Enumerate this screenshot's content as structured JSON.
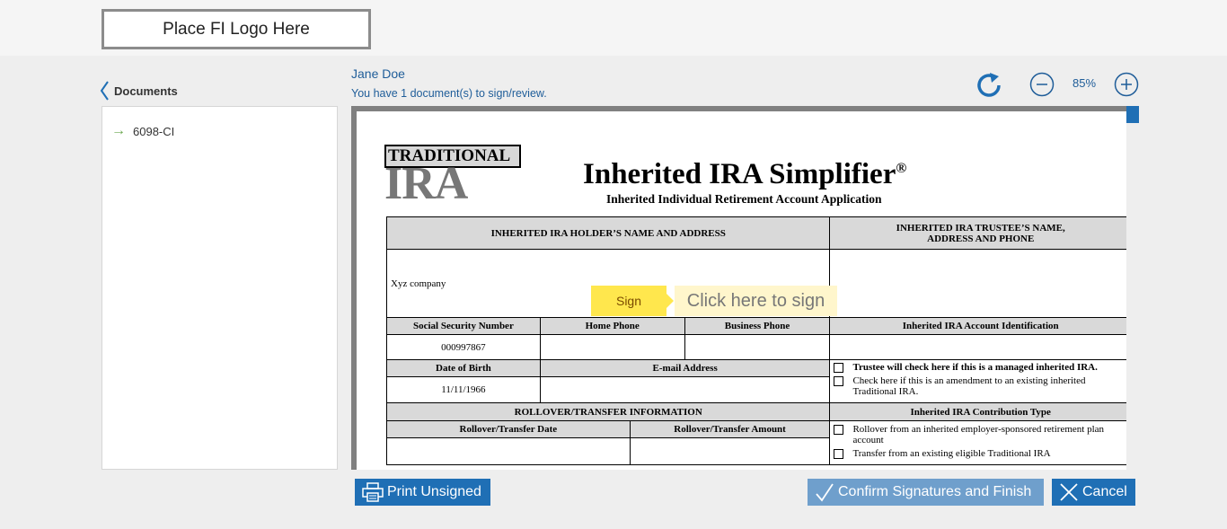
{
  "header": {
    "logo_placeholder": "Place FI Logo Here"
  },
  "sidebar": {
    "back_label": "Documents",
    "documents": [
      {
        "name": "6098-CI"
      }
    ]
  },
  "viewer_header": {
    "user_name": "Jane Doe",
    "status_text": "You have 1 document(s) to sign/review.",
    "zoom_level": "85%"
  },
  "document": {
    "logo_top": "TRADITIONAL",
    "logo_bottom": "IRA",
    "title": "Inherited IRA Simplifier",
    "title_mark": "®",
    "subtitle": "Inherited Individual Retirement Account Application",
    "holder_header": "INHERITED IRA HOLDER’S NAME AND ADDRESS",
    "trustee_header_line1": "INHERITED IRA TRUSTEE’S NAME,",
    "trustee_header_line2": "ADDRESS AND PHONE",
    "holder_name": "Xyz company",
    "ssn_label": "Social Security Number",
    "home_phone_label": "Home Phone",
    "business_phone_label": "Business Phone",
    "account_id_label": "Inherited IRA Account Identification",
    "ssn_value": "000997867",
    "dob_label": "Date of Birth",
    "email_label": "E-mail Address",
    "dob_value": "11/11/1966",
    "trustee_check_1": "Trustee will check here if this is a managed inherited IRA.",
    "trustee_check_2": "Check here if this is an amendment to an existing inherited Traditional IRA.",
    "rollover_header": "ROLLOVER/TRANSFER INFORMATION",
    "contribution_header": "Inherited IRA Contribution Type",
    "rollover_date_label": "Rollover/Transfer Date",
    "rollover_amount_label": "Rollover/Transfer Amount",
    "contribution_opt_1": "Rollover from an inherited employer-sponsored retirement plan account",
    "contribution_opt_2": "Transfer from an existing eligible Traditional IRA"
  },
  "sign": {
    "button_label": "Sign",
    "hint": "Click here to sign"
  },
  "footer": {
    "print_label": "Print Unsigned",
    "confirm_label": "Confirm Signatures and Finish",
    "cancel_label": "Cancel"
  },
  "colors": {
    "accent": "#1f6fb5",
    "accent_muted": "#6f9fcc",
    "sign_yellow": "#ffe74d",
    "link_blue": "#1f5d99"
  }
}
